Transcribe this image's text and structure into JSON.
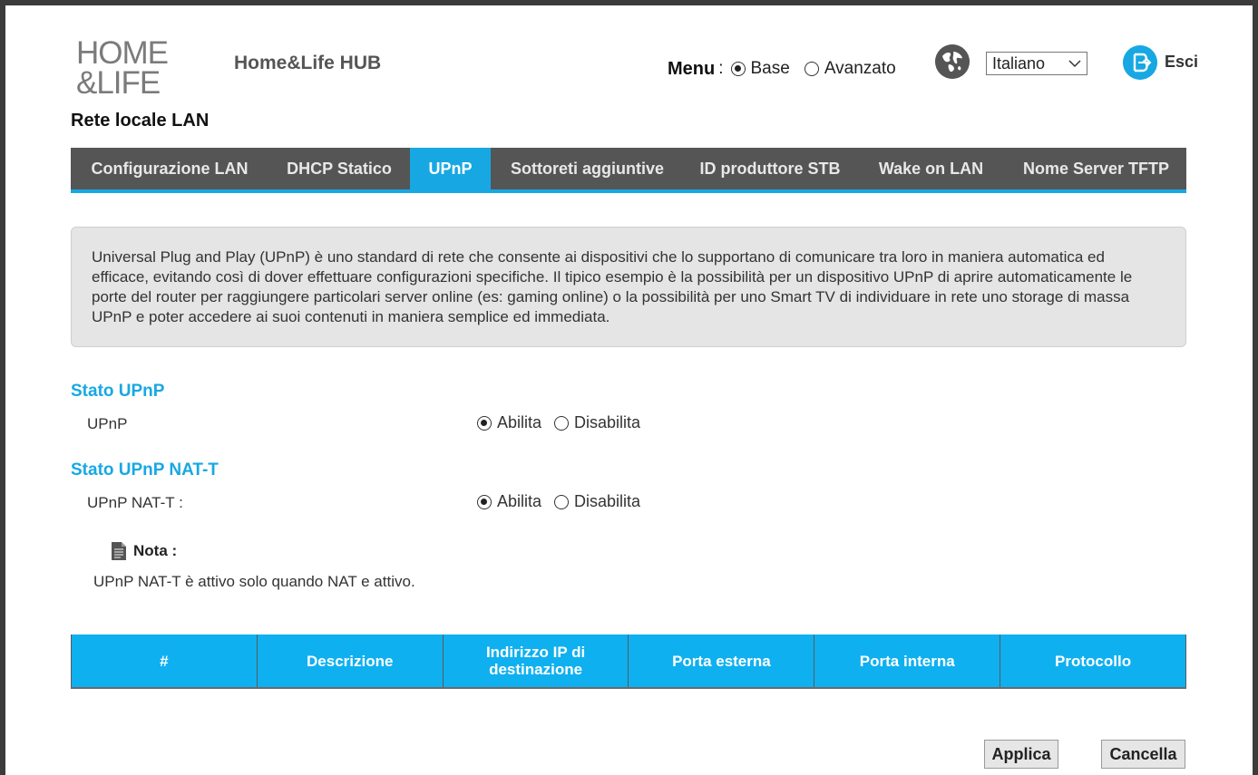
{
  "header": {
    "logo_line1": "HOME",
    "logo_line2": "&LIFE",
    "app_title": "Home&Life HUB",
    "menu_label": "Menu",
    "menu_colon": ":",
    "menu_options": [
      {
        "label": "Base",
        "selected": true
      },
      {
        "label": "Avanzato",
        "selected": false
      }
    ],
    "language": "Italiano",
    "logout_label": "Esci"
  },
  "page_title": "Rete locale LAN",
  "tabs": [
    {
      "label": "Configurazione LAN",
      "active": false
    },
    {
      "label": "DHCP Statico",
      "active": false
    },
    {
      "label": "UPnP",
      "active": true
    },
    {
      "label": "Sottoreti aggiuntive",
      "active": false
    },
    {
      "label": "ID produttore STB",
      "active": false
    },
    {
      "label": "Wake on LAN",
      "active": false
    },
    {
      "label": "Nome Server TFTP",
      "active": false
    }
  ],
  "info_text": "Universal Plug and Play (UPnP) è uno standard di rete che consente ai dispositivi che lo supportano di comunicare tra loro in maniera automatica ed efficace, evitando così di dover effettuare configurazioni specifiche. Il tipico esempio è la possibilità per un dispositivo UPnP di aprire automaticamente le porte del router per raggiungere particolari server online (es: gaming online) o la possibilità per uno Smart TV di individuare in rete uno storage di massa UPnP e poter accedere ai suoi contenuti in maniera semplice ed immediata.",
  "upnp_section": {
    "title": "Stato UPnP",
    "field_label": "UPnP",
    "enable_label": "Abilita",
    "disable_label": "Disabilita",
    "value": "Abilita"
  },
  "natt_section": {
    "title": "Stato UPnP NAT-T",
    "field_label": "UPnP NAT-T :",
    "enable_label": "Abilita",
    "disable_label": "Disabilita",
    "value": "Abilita"
  },
  "note": {
    "label": "Nota :",
    "text": "UPnP NAT-T è attivo solo quando NAT e attivo."
  },
  "table": {
    "headers": [
      "#",
      "Descrizione",
      "Indirizzo IP di destinazione",
      "Porta esterna",
      "Porta interna",
      "Protocollo"
    ]
  },
  "buttons": {
    "apply": "Applica",
    "cancel": "Cancella"
  },
  "colors": {
    "accent": "#17a8e3",
    "tab_bg": "#555555",
    "table_header": "#0fb0f0"
  }
}
